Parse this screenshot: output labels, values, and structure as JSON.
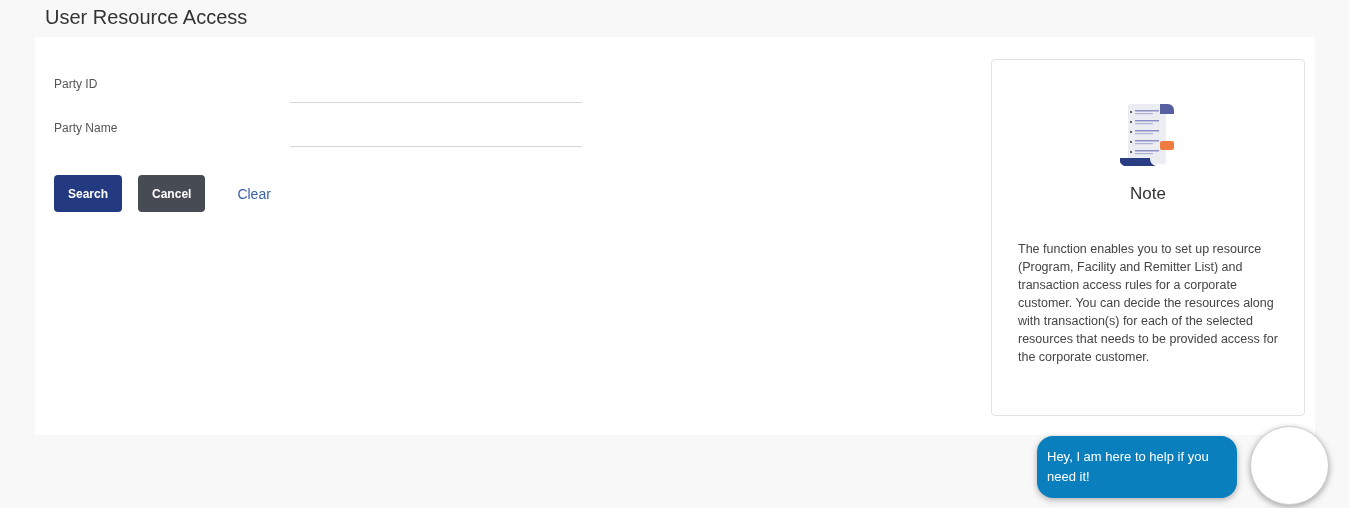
{
  "page": {
    "title": "User Resource Access"
  },
  "fields": [
    {
      "label": "Party ID"
    },
    {
      "label": "Party Name"
    }
  ],
  "buttons": [
    {
      "label": "Search",
      "kind": "primary"
    },
    {
      "label": "Cancel",
      "kind": "secondary"
    },
    {
      "label": "Clear",
      "kind": "link"
    }
  ],
  "note": {
    "title": "Note",
    "text": "The function enables you to set up resource (Program, Facility and Remitter List) and transaction access rules for a corporate customer. You can decide the resources along with transaction(s) for each of the selected resources that needs to be provided access for the corporate customer."
  },
  "chat": {
    "message": "Hey, I am here to help if you need it!"
  }
}
